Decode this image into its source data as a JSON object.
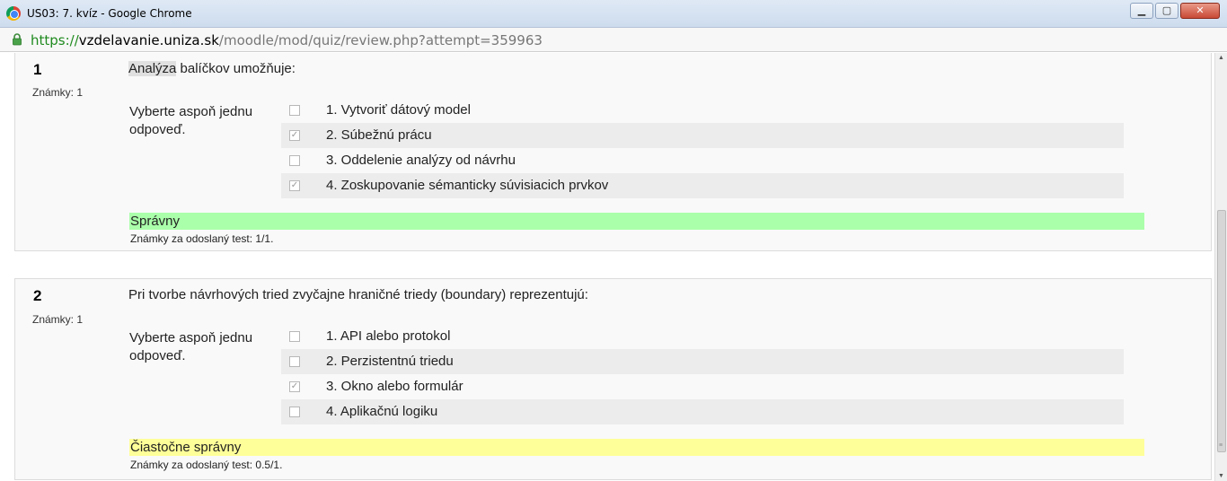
{
  "window": {
    "title": "US03: 7. kvíz - Google Chrome",
    "controls": {
      "minimize": "▁",
      "maximize": "▢",
      "close": "✕"
    }
  },
  "address_bar": {
    "scheme": "https://",
    "host": "vzdelavanie.uniza.sk",
    "path": "/moodle/mod/quiz/review.php?attempt=359963"
  },
  "questions": [
    {
      "number": "1",
      "marks": "Známky: 1",
      "text_highlight": "Analýza",
      "text_rest": " balíčkov umožňuje:",
      "prompt": "Vyberte aspoň jednu odpoveď.",
      "answers": [
        {
          "label": "1. Vytvoriť dátový model",
          "checked": false
        },
        {
          "label": "2. Súbežnú prácu",
          "checked": true
        },
        {
          "label": "3. Oddelenie analýzy od návrhu",
          "checked": false
        },
        {
          "label": "4. Zoskupovanie sémanticky súvisiacich prvkov",
          "checked": true
        }
      ],
      "feedback": "Správny",
      "feedback_color": "#aaffaa",
      "grade": "Známky za odoslaný test: 1/1."
    },
    {
      "number": "2",
      "marks": "Známky: 1",
      "text_highlight": "",
      "text_rest": "Pri tvorbe návrhových tried zvyčajne hraničné triedy (boundary) reprezentujú:",
      "prompt": "Vyberte aspoň jednu odpoveď.",
      "answers": [
        {
          "label": "1. API alebo protokol",
          "checked": false
        },
        {
          "label": "2. Perzistentnú triedu",
          "checked": false
        },
        {
          "label": "3. Okno alebo formulár",
          "checked": true
        },
        {
          "label": "4. Aplikačnú logiku",
          "checked": false
        }
      ],
      "feedback": "Čiastočne správny",
      "feedback_color": "#ffff99",
      "grade": "Známky za odoslaný test: 0.5/1."
    }
  ]
}
